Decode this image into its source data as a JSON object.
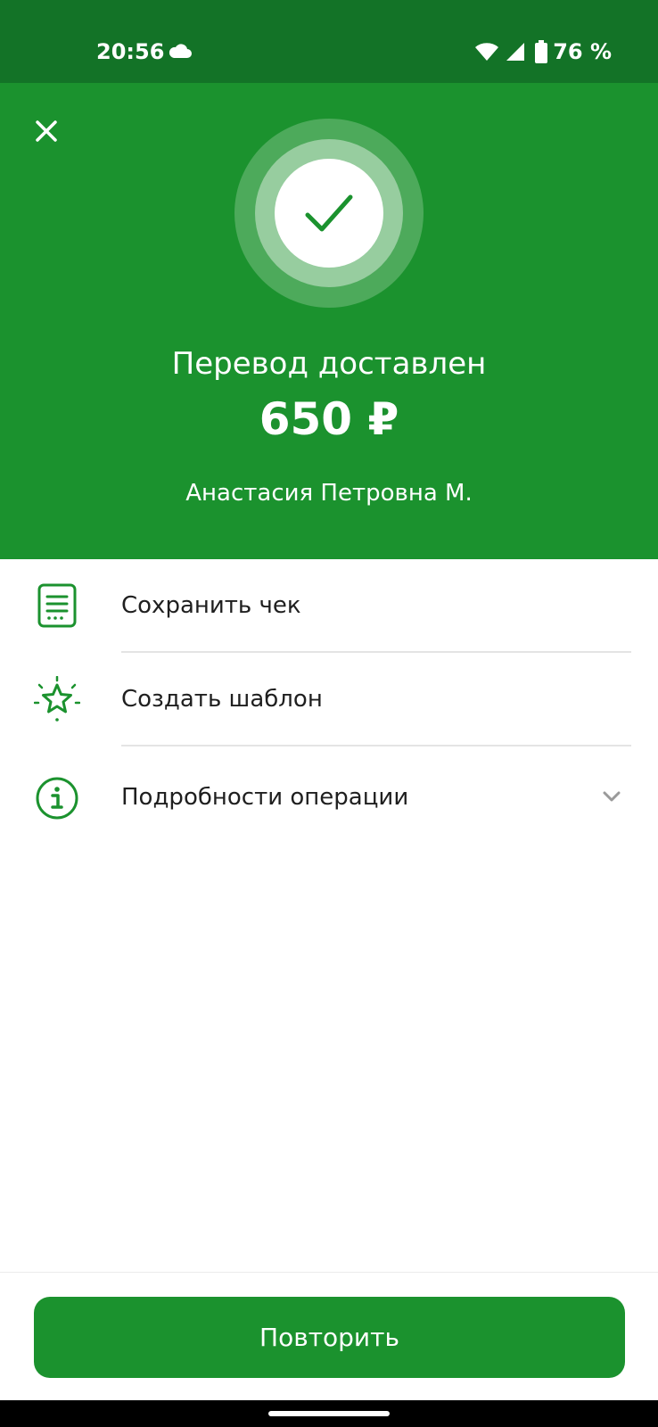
{
  "status_bar": {
    "time": "20:56",
    "battery": "76 %",
    "icons": [
      "cloud-icon",
      "wifi-icon",
      "cellular-signal-icon",
      "battery-icon"
    ]
  },
  "header": {
    "close_icon": "close-icon",
    "status_icon": "checkmark-icon",
    "status_text": "Перевод доставлен",
    "amount": "650 ₽",
    "recipient": "Анастасия Петровна М."
  },
  "actions": [
    {
      "label": "Сохранить чек",
      "icon": "receipt-icon"
    },
    {
      "label": "Создать шаблон",
      "icon": "star-icon"
    },
    {
      "label": "Подробности операции",
      "icon": "info-icon",
      "trailing_icon": "chevron-down-icon"
    }
  ],
  "footer": {
    "repeat_label": "Повторить"
  },
  "colors": {
    "status_bar": "#137327",
    "accent_green": "#1b922e",
    "text": "#1f1f1f",
    "divider": "#e4e4e4"
  }
}
